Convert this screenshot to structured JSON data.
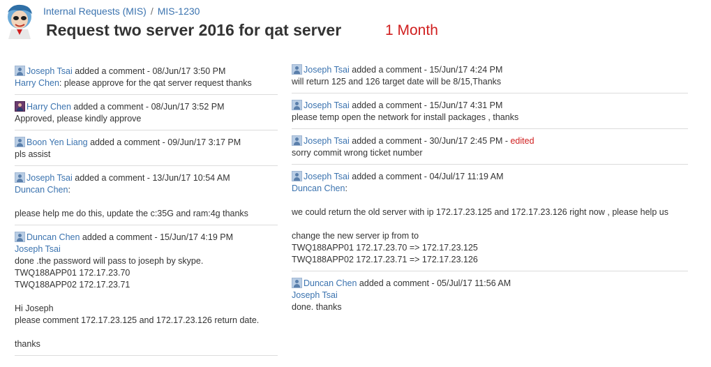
{
  "header": {
    "project": "Internal Requests (MIS)",
    "separator": "/",
    "issue_key": "MIS-1230",
    "title": "Request two server 2016 for qat server",
    "badge": "1 Month"
  },
  "colors": {
    "link": "#3b73af",
    "badge": "#d01f1f",
    "divider": "#dcdcdc"
  },
  "left_comments": [
    {
      "author": "Joseph Tsai",
      "meta": " added a comment - 08/Jun/17 3:50 PM",
      "mention": "Harry Chen",
      "line1": ": please approve for the qat server request thanks"
    },
    {
      "author": "Harry Chen",
      "meta": " added a comment - 08/Jun/17 3:52 PM",
      "line1": "Approved, please kindly approve"
    },
    {
      "author": "Boon Yen Liang",
      "meta": " added a comment - 09/Jun/17 3:17 PM",
      "line1": "pls assist"
    },
    {
      "author": "Joseph Tsai",
      "meta": " added a comment - 13/Jun/17 10:54 AM",
      "mention": "Duncan Chen",
      "mention_suffix": ":",
      "line1": "please help me do this, update the c:35G and ram:4g thanks"
    },
    {
      "author": "Duncan Chen",
      "meta": " added a comment - 15/Jun/17 4:19 PM",
      "mention": "Joseph Tsai",
      "line1": "done .the password will pass to joseph by skype.",
      "line2": "TWQ188APP01 172.17.23.70",
      "line3": "TWQ188APP02 172.17.23.71",
      "line4": "Hi Joseph",
      "line5": "please comment 172.17.23.125 and 172.17.23.126 return date.",
      "line6": "thanks"
    }
  ],
  "right_comments": [
    {
      "author": "Joseph Tsai",
      "meta": " added a comment - 15/Jun/17 4:24 PM",
      "line1": "will return 125 and 126 target date will be 8/15,Thanks"
    },
    {
      "author": "Joseph Tsai",
      "meta": " added a comment - 15/Jun/17 4:31 PM",
      "line1": "please temp open the network for install packages , thanks"
    },
    {
      "author": "Joseph Tsai",
      "meta": " added a comment - 30/Jun/17 2:45 PM - ",
      "edited": "edited",
      "line1": "sorry commit wrong ticket number"
    },
    {
      "author": "Joseph Tsai",
      "meta": " added a comment - 04/Jul/17 11:19 AM",
      "mention": "Duncan Chen",
      "mention_suffix": ":",
      "line1": "we could return the old server with ip 172.17.23.125 and 172.17.23.126 right now , please help us",
      "line2": "change the new server ip from to",
      "line3": "TWQ188APP01 172.17.23.70 => 172.17.23.125",
      "line4": "TWQ188APP02 172.17.23.71 => 172.17.23.126"
    },
    {
      "author": "Duncan Chen",
      "meta": " added a comment - 05/Jul/17 11:56 AM",
      "mention": "Joseph Tsai",
      "line1": "done. thanks"
    }
  ]
}
